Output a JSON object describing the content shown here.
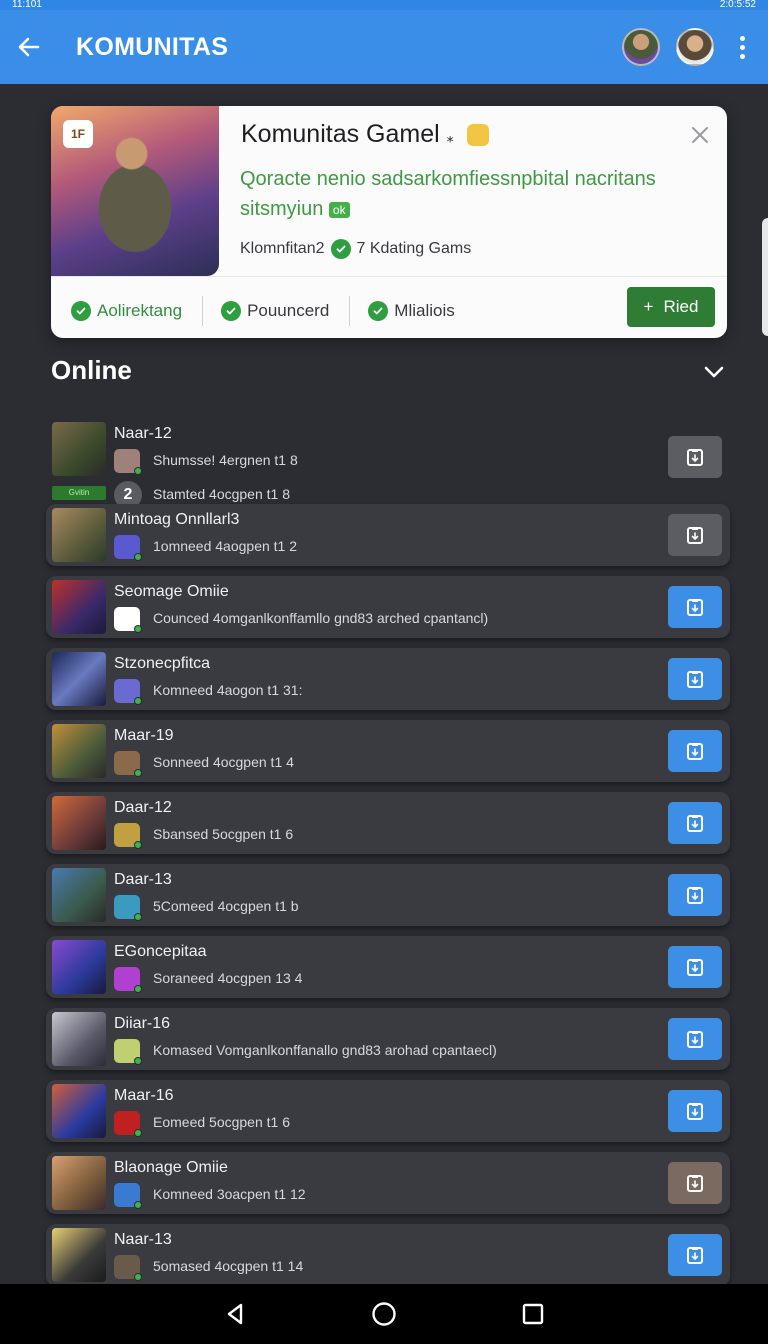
{
  "status_bar": {
    "time": "11:101",
    "right": "2:0:5:52"
  },
  "app_bar": {
    "title": "KOMUNITAS"
  },
  "featured": {
    "badge": "1F",
    "title": "Komunitas Gamel",
    "title_suffix": "⁎",
    "description": "Qoracte nenio sadsarkomfiessnpbital nacritans sitsmyiun",
    "description_tag": "ok",
    "meta": "Klomnfitan2",
    "meta_suffix": "7 Kdating Gams",
    "tags": [
      "Aolirektang",
      "Pouuncerd",
      "Mlialiois"
    ],
    "join_label": "Ried",
    "colors": {
      "accent_green": "#2f7d35",
      "text_green": "#3f9a42"
    }
  },
  "online": {
    "title": "Online",
    "first_extra": {
      "tag": "Gvitin",
      "number": "2",
      "text": "Stamted 4ocgpen t1 8"
    },
    "rows": [
      {
        "name": "Naar-12",
        "sub": "Shumsse! 4ergnen t1 8",
        "btn": "gray"
      },
      {
        "name": "Mintoag Onnllarl3",
        "sub": "1omneed 4aogpen t1 2",
        "btn": "gray"
      },
      {
        "name": "Seomage Omiie",
        "sub": "Counced 4omganlkonffamllo gnd83 arched cpantancl)",
        "btn": "blue"
      },
      {
        "name": "Stzonecpfitca",
        "sub": "Komneed 4aogon t1 31:",
        "btn": "blue"
      },
      {
        "name": "Maar-19",
        "sub": "Sonneed 4ocgpen t1 4",
        "btn": "blue"
      },
      {
        "name": "Daar-12",
        "sub": "Sbansed 5ocgpen t1 6",
        "btn": "blue"
      },
      {
        "name": "Daar-13",
        "sub": "5Comeed 4ocgpen t1 b",
        "btn": "blue"
      },
      {
        "name": "EGoncepitaa",
        "sub": "Soraneed 4ocgpen 13 4",
        "btn": "blue"
      },
      {
        "name": "Diiar-16",
        "sub": "Komased Vomganlkonffanallo gnd83 arohad cpantaecl)",
        "btn": "blue"
      },
      {
        "name": "Maar-16",
        "sub": "Eomeed 5ocgpen t1 6",
        "btn": "blue"
      },
      {
        "name": "Blaonage Omiie",
        "sub": "Komneed 3oacpen t1 12",
        "btn": "brown"
      },
      {
        "name": "Naar-13",
        "sub": "5omased 4ocgpen t1 14",
        "btn": "blue"
      }
    ]
  }
}
